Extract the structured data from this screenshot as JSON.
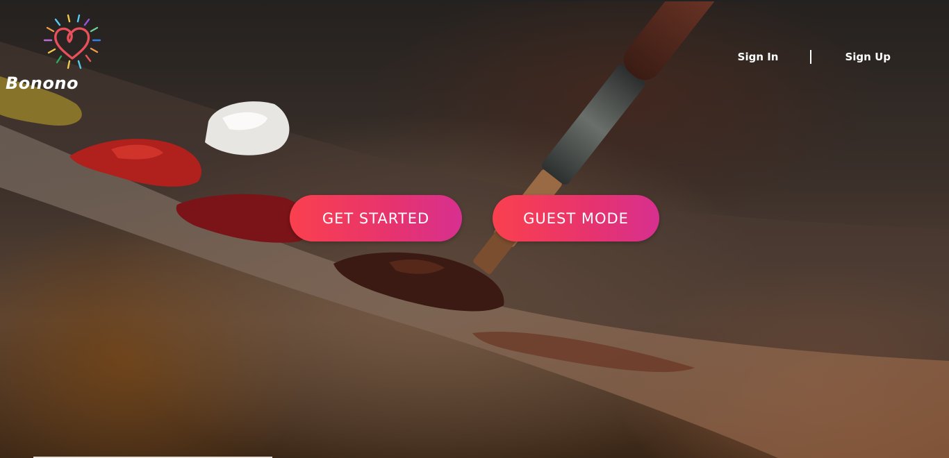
{
  "brand": {
    "name": "Bonono"
  },
  "nav": {
    "sign_in": "Sign In",
    "sign_up": "Sign Up"
  },
  "actions": {
    "get_started": "GET STARTED",
    "guest_mode": "GUEST MODE"
  },
  "colors": {
    "cta_gradient_start": "#fa404e",
    "cta_gradient_end": "#d7308f",
    "logo_heart": "#e8505b",
    "nav_text": "#ffffff"
  },
  "background": {
    "subject": "painter's palette with paint brush"
  }
}
